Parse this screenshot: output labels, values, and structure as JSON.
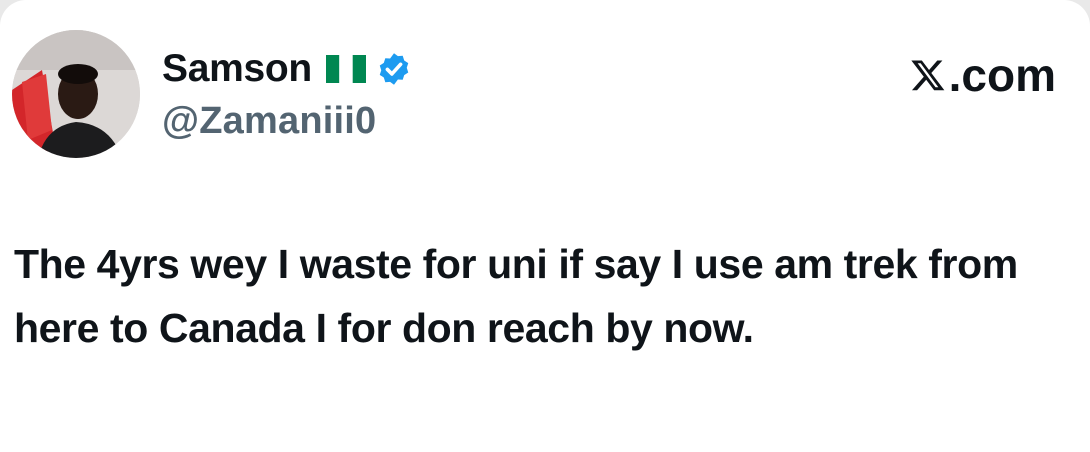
{
  "author": {
    "name": "Samson",
    "handle": "@Zamaniii0",
    "flag": "nigeria-flag-icon",
    "verified": true
  },
  "brand": {
    "label": ".com",
    "icon": "x-logo-icon"
  },
  "tweet": {
    "text": "The 4yrs wey I waste for uni if say I use am trek from here to Canada I for don reach by now."
  },
  "colors": {
    "verified_blue": "#1d9bf0",
    "flag_green": "#008751",
    "handle_gray": "#536471",
    "text_dark": "#0f1419"
  }
}
